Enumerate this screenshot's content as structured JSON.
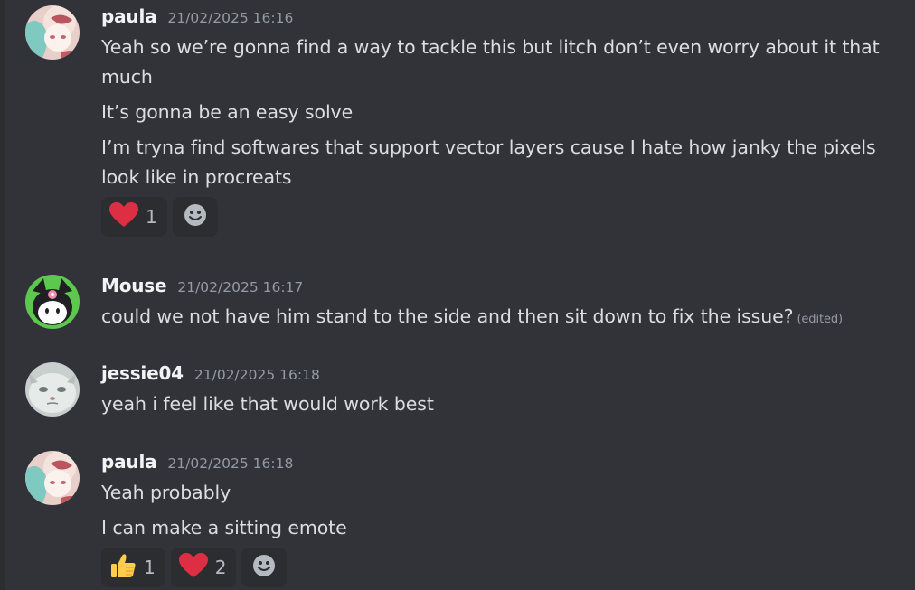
{
  "messages": [
    {
      "author": "paula",
      "timestamp": "21/02/2025 16:16",
      "lines": [
        "Yeah so we’re gonna find a way to tackle this but litch don’t even worry about it that much",
        "It’s gonna be an easy solve",
        "I’m tryna find softwares that support vector layers cause I hate how janky the pixels look like in procreats"
      ],
      "reactions": [
        {
          "emoji": "heart-icon",
          "count": "1"
        }
      ]
    },
    {
      "author": "Mouse",
      "timestamp": "21/02/2025 16:17",
      "lines": [
        "could we not have him stand to the side and then sit down to fix the issue?"
      ],
      "edited_label": "(edited)"
    },
    {
      "author": "jessie04",
      "timestamp": "21/02/2025 16:18",
      "lines": [
        "yeah i feel like that would work best"
      ]
    },
    {
      "author": "paula",
      "timestamp": "21/02/2025 16:18",
      "lines": [
        "Yeah probably",
        "I can make a sitting emote"
      ],
      "reactions": [
        {
          "emoji": "thumbs-up-icon",
          "count": "1"
        },
        {
          "emoji": "heart-icon",
          "count": "2"
        }
      ]
    }
  ],
  "colors": {
    "background": "#313338",
    "username": "#f2f3f5",
    "text": "#dbdee1",
    "muted": "#949ba4",
    "reaction_bg": "#2b2d31",
    "heart": "#dd2e44",
    "thumbs": "#ffcc4d"
  }
}
